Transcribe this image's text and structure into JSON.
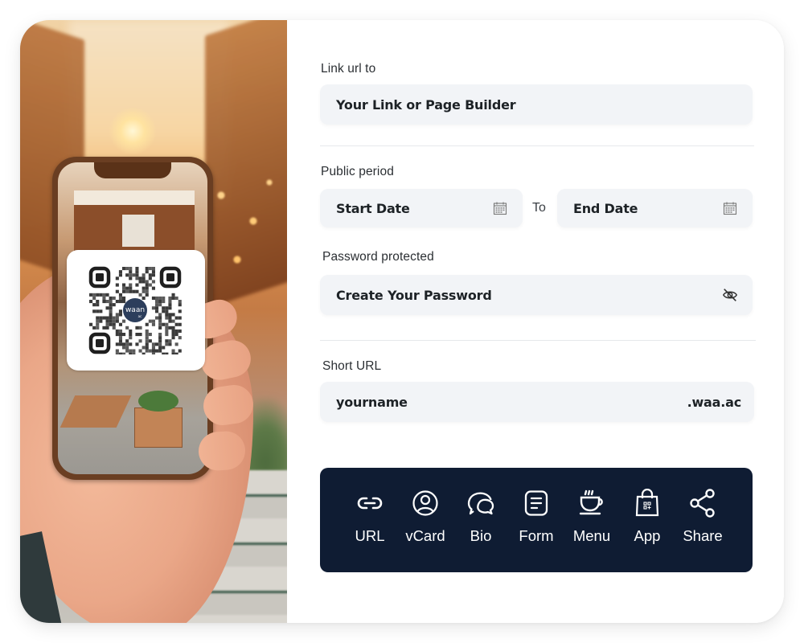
{
  "hero": {
    "qr_logo_text": "waan",
    "qr_logo_sub": "ac",
    "qr_logo_color": "#2c3e5c"
  },
  "form": {
    "link": {
      "label": "Link url to",
      "placeholder": "Your Link or Page Builder"
    },
    "period": {
      "label": "Public period",
      "start_placeholder": "Start Date",
      "separator": "To",
      "end_placeholder": "End Date",
      "icon": "calendar-icon"
    },
    "password": {
      "label": "Password protected",
      "placeholder": "Create Your Password",
      "icon": "eye-off-icon"
    },
    "short_url": {
      "label": "Short URL",
      "placeholder": "yourname",
      "suffix": ".waa.ac"
    }
  },
  "types": {
    "background": "#0f1c33",
    "items": [
      {
        "label": "URL",
        "icon": "link-icon"
      },
      {
        "label": "vCard",
        "icon": "user-circle-icon"
      },
      {
        "label": "Bio",
        "icon": "chat-bubbles-icon"
      },
      {
        "label": "Form",
        "icon": "form-document-icon"
      },
      {
        "label": "Menu",
        "icon": "coffee-cup-icon"
      },
      {
        "label": "App",
        "icon": "shopping-bag-icon"
      },
      {
        "label": "Share",
        "icon": "share-icon"
      }
    ]
  },
  "colors": {
    "field_bg": "#f2f4f7",
    "text_dark": "#1d2226"
  }
}
